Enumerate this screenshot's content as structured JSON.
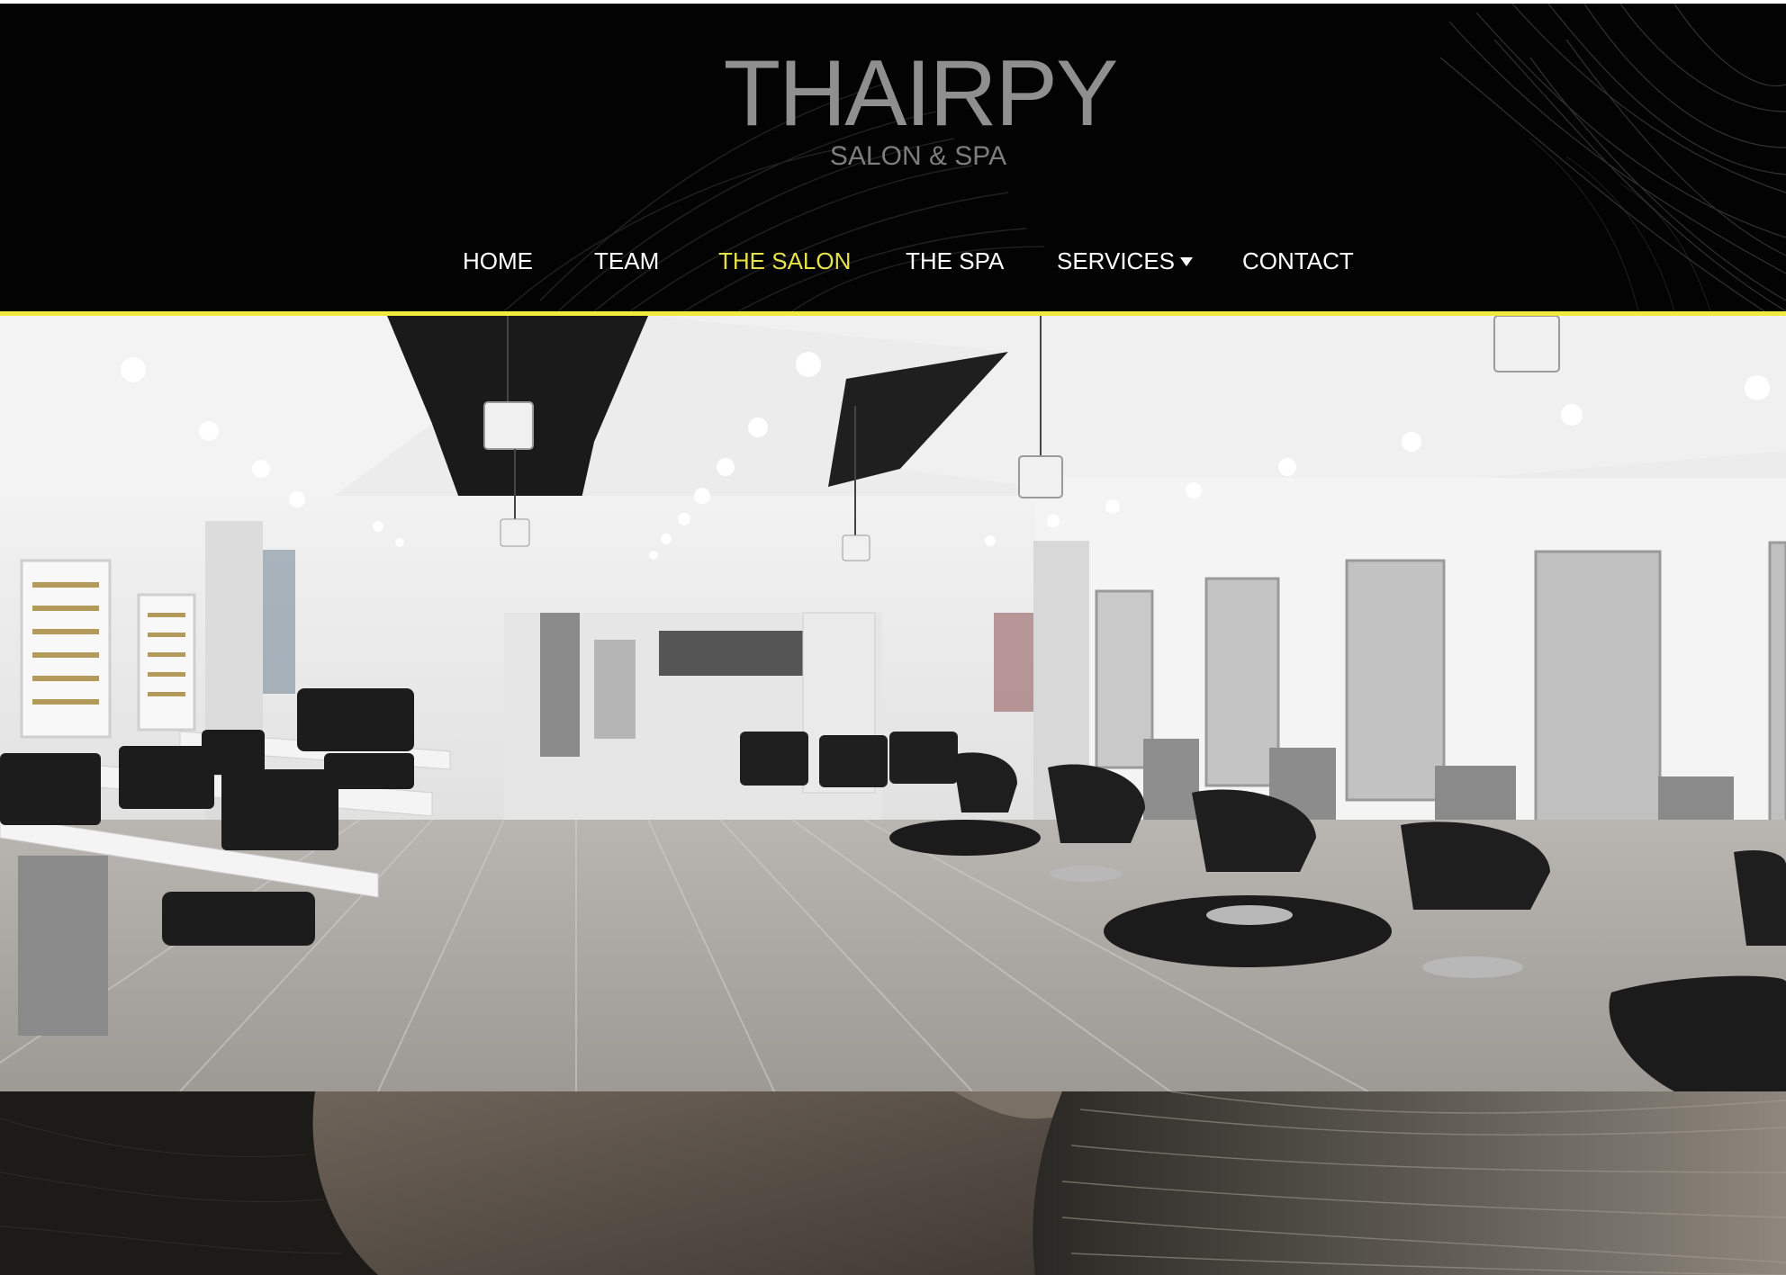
{
  "brand": {
    "name": "THAIRPY",
    "tagline": "SALON & SPA"
  },
  "nav": {
    "items": [
      {
        "label": "HOME"
      },
      {
        "label": "TEAM"
      },
      {
        "label": "THE SALON"
      },
      {
        "label": "THE SPA"
      },
      {
        "label": "SERVICES"
      },
      {
        "label": "CONTACT"
      }
    ],
    "active": "THE SALON"
  },
  "colors": {
    "header_bg": "#030303",
    "nav_text": "#ffffff",
    "nav_active": "#e6e14a",
    "accent_line": "#f2ea3c",
    "logo_text": "#8f8f8f"
  },
  "icons": {
    "services_dropdown": "caret-down-icon"
  }
}
